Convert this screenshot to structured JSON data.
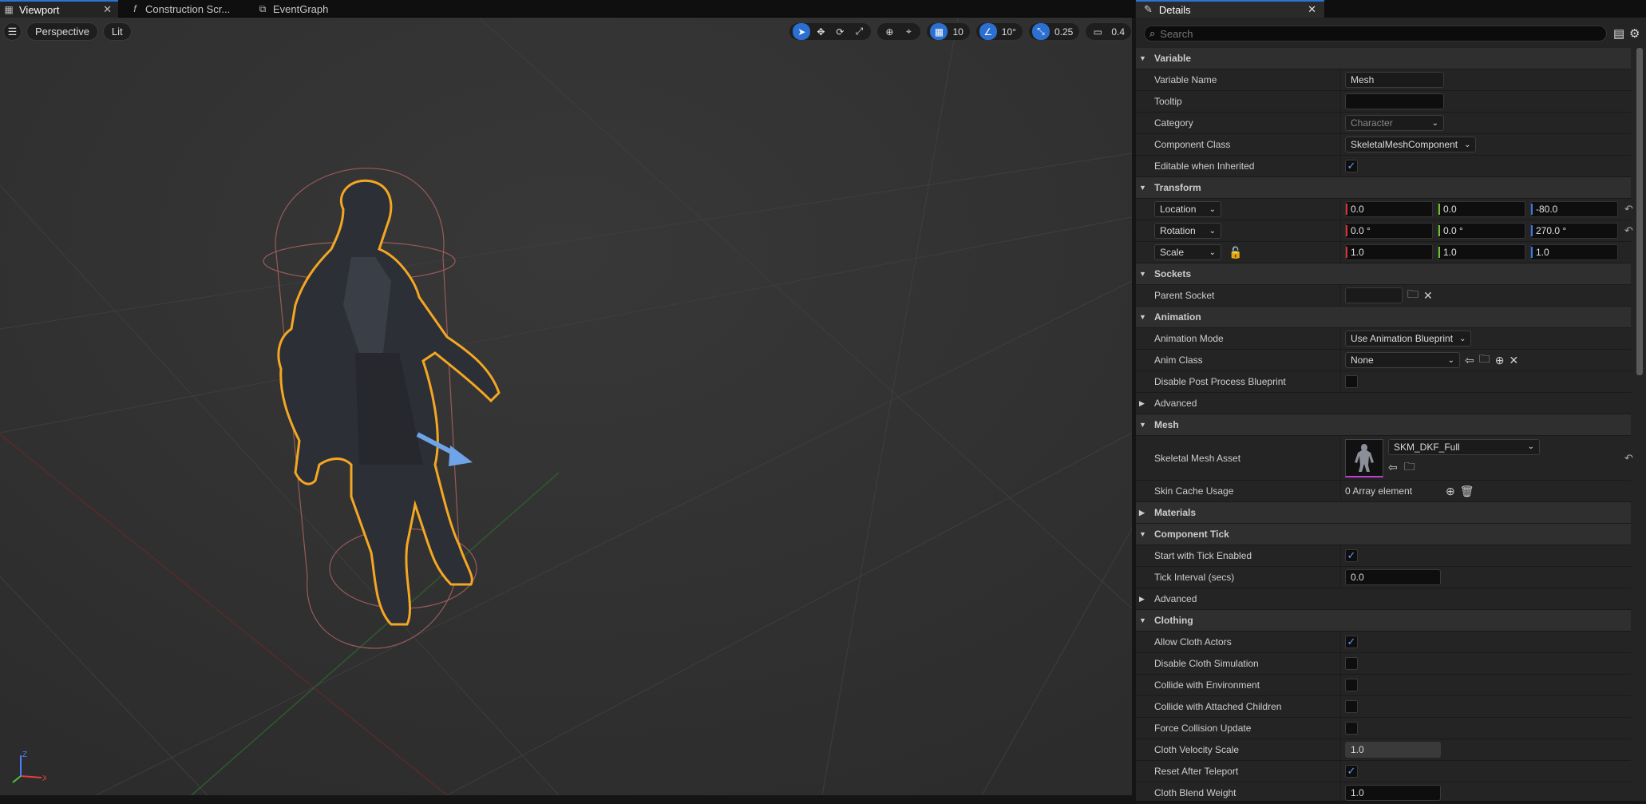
{
  "tabs": [
    {
      "label": "Viewport",
      "icon": "viewport-icon",
      "active": true
    },
    {
      "label": "Construction Scr...",
      "icon": "function-icon"
    },
    {
      "label": "EventGraph",
      "icon": "graph-icon"
    }
  ],
  "viewport": {
    "view_mode": "Perspective",
    "lighting": "Lit",
    "grid_snap": "10",
    "rotation_snap": "10°",
    "scale_snap": "0.25",
    "camera_speed": "0.4"
  },
  "details": {
    "title": "Details",
    "search_placeholder": "Search",
    "sections": {
      "variable": {
        "title": "Variable",
        "variable_name_label": "Variable Name",
        "variable_name": "Mesh",
        "tooltip_label": "Tooltip",
        "tooltip": "",
        "category_label": "Category",
        "category": "Character",
        "component_class_label": "Component Class",
        "component_class": "SkeletalMeshComponent",
        "editable_label": "Editable when Inherited",
        "editable": true
      },
      "transform": {
        "title": "Transform",
        "location_label": "Location",
        "location": [
          "0.0",
          "0.0",
          "-80.0"
        ],
        "rotation_label": "Rotation",
        "rotation": [
          "0.0 °",
          "0.0 °",
          "270.0 °"
        ],
        "scale_label": "Scale",
        "scale": [
          "1.0",
          "1.0",
          "1.0"
        ]
      },
      "sockets": {
        "title": "Sockets",
        "parent_socket_label": "Parent Socket",
        "parent_socket": ""
      },
      "animation": {
        "title": "Animation",
        "mode_label": "Animation Mode",
        "mode": "Use Animation Blueprint",
        "anim_class_label": "Anim Class",
        "anim_class": "None",
        "disable_pp_label": "Disable Post Process Blueprint",
        "advanced": "Advanced"
      },
      "mesh": {
        "title": "Mesh",
        "asset_label": "Skeletal Mesh Asset",
        "asset": "SKM_DKF_Full",
        "skin_cache_label": "Skin Cache Usage",
        "skin_cache": "0 Array element"
      },
      "materials": {
        "title": "Materials"
      },
      "component_tick": {
        "title": "Component Tick",
        "start_tick_label": "Start with Tick Enabled",
        "tick_interval_label": "Tick Interval (secs)",
        "tick_interval": "0.0",
        "advanced": "Advanced"
      },
      "clothing": {
        "title": "Clothing",
        "allow_label": "Allow Cloth Actors",
        "disable_sim_label": "Disable Cloth Simulation",
        "collide_env_label": "Collide with Environment",
        "collide_children_label": "Collide with Attached Children",
        "force_collision_label": "Force Collision Update",
        "velocity_scale_label": "Cloth Velocity Scale",
        "velocity_scale": "1.0",
        "reset_teleport_label": "Reset After Teleport",
        "blend_weight_label": "Cloth Blend Weight",
        "blend_weight": "1.0"
      }
    }
  },
  "colors": {
    "accent": "#2a74d6",
    "selection": "#f0a020"
  }
}
